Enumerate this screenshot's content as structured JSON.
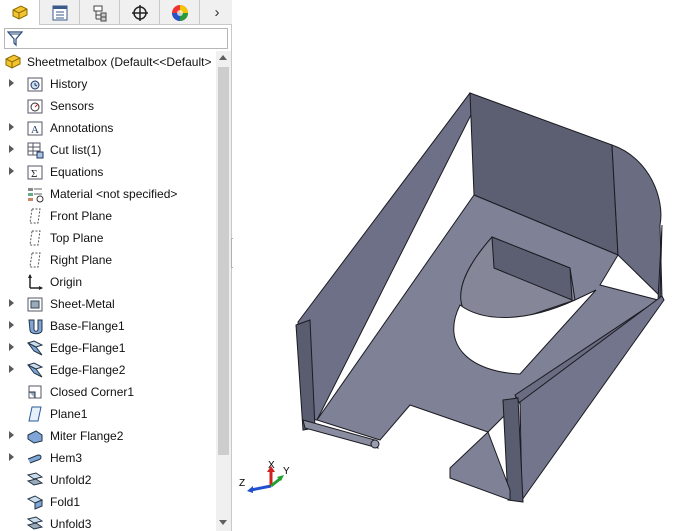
{
  "panel": {
    "tabs": [
      {
        "name": "feature-manager-tab",
        "icon": "feature-manager-icon",
        "active": true
      },
      {
        "name": "property-manager-tab",
        "icon": "property-manager-icon"
      },
      {
        "name": "configuration-manager-tab",
        "icon": "configuration-manager-icon"
      },
      {
        "name": "dimxpert-manager-tab",
        "icon": "dimxpert-icon"
      },
      {
        "name": "display-manager-tab",
        "icon": "display-manager-icon"
      }
    ],
    "more_tabs_glyph": "›",
    "filter": {
      "icon": "filter-icon",
      "value": ""
    }
  },
  "tree": {
    "root": {
      "label": "Sheetmetalbox  (Default<<Default>",
      "icon": "part-icon"
    },
    "items": [
      {
        "label": "History",
        "icon": "history-icon",
        "expandable": true
      },
      {
        "label": "Sensors",
        "icon": "sensors-icon",
        "expandable": false
      },
      {
        "label": "Annotations",
        "icon": "annotations-icon",
        "expandable": true
      },
      {
        "label": "Cut list(1)",
        "icon": "cut-list-icon",
        "expandable": true
      },
      {
        "label": "Equations",
        "icon": "equations-icon",
        "expandable": true
      },
      {
        "label": "Material <not specified>",
        "icon": "material-icon",
        "expandable": false
      },
      {
        "label": "Front Plane",
        "icon": "plane-icon",
        "expandable": false
      },
      {
        "label": "Top Plane",
        "icon": "plane-icon",
        "expandable": false
      },
      {
        "label": "Right Plane",
        "icon": "plane-icon",
        "expandable": false
      },
      {
        "label": "Origin",
        "icon": "origin-icon",
        "expandable": false
      },
      {
        "label": "Sheet-Metal",
        "icon": "sheet-metal-icon",
        "expandable": true
      },
      {
        "label": "Base-Flange1",
        "icon": "base-flange-icon",
        "expandable": true
      },
      {
        "label": "Edge-Flange1",
        "icon": "edge-flange-icon",
        "expandable": true
      },
      {
        "label": "Edge-Flange2",
        "icon": "edge-flange-icon",
        "expandable": true
      },
      {
        "label": "Closed Corner1",
        "icon": "closed-corner-icon",
        "expandable": false
      },
      {
        "label": "Plane1",
        "icon": "plane-feature-icon",
        "expandable": false
      },
      {
        "label": "Miter Flange2",
        "icon": "miter-flange-icon",
        "expandable": true
      },
      {
        "label": "Hem3",
        "icon": "hem-icon",
        "expandable": true
      },
      {
        "label": "Unfold2",
        "icon": "unfold-icon",
        "expandable": false
      },
      {
        "label": "Fold1",
        "icon": "fold-icon",
        "expandable": false
      },
      {
        "label": "Unfold3",
        "icon": "unfold-icon",
        "expandable": false
      }
    ]
  },
  "viewport": {
    "model": "sheet-metal-box",
    "triad": {
      "x": "X",
      "y": "Y",
      "z": "Z"
    },
    "colors": {
      "part_face": "#7d7f96",
      "part_dark": "#5c5e72",
      "part_light": "#9a9cb0",
      "edge": "#1b1b22",
      "background": "#ffffff"
    }
  }
}
